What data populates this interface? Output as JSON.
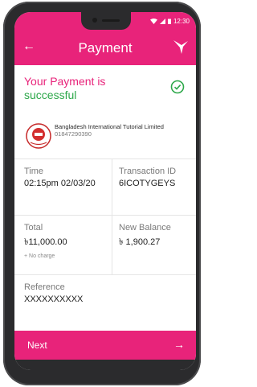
{
  "statusbar": {
    "time": "12:30"
  },
  "appbar": {
    "back_icon": "arrow-left-icon",
    "title": "Payment",
    "brand_icon": "bird-logo-icon"
  },
  "status": {
    "line1_a": "Your ",
    "line1_b": "Payment is",
    "line2": "successful",
    "check_icon": "check-circle-icon"
  },
  "merchant": {
    "name": "Bangladesh International Tutorial Limited",
    "phone": "01847290390"
  },
  "details": {
    "time_label": "Time",
    "time_value": "02:15pm 02/03/20",
    "txn_label": "Transaction ID",
    "txn_value": "6ICOTYGEYS",
    "total_label": "Total",
    "total_value": "৳11,000.00",
    "total_sub": "+ No charge",
    "balance_label": "New Balance",
    "balance_value": "৳ 1,900.27",
    "reference_label": "Reference",
    "reference_value": "XXXXXXXXXX"
  },
  "footer": {
    "next_label": "Next",
    "next_icon": "arrow-right-icon"
  },
  "colors": {
    "accent": "#e8237a",
    "success": "#2da84a"
  }
}
